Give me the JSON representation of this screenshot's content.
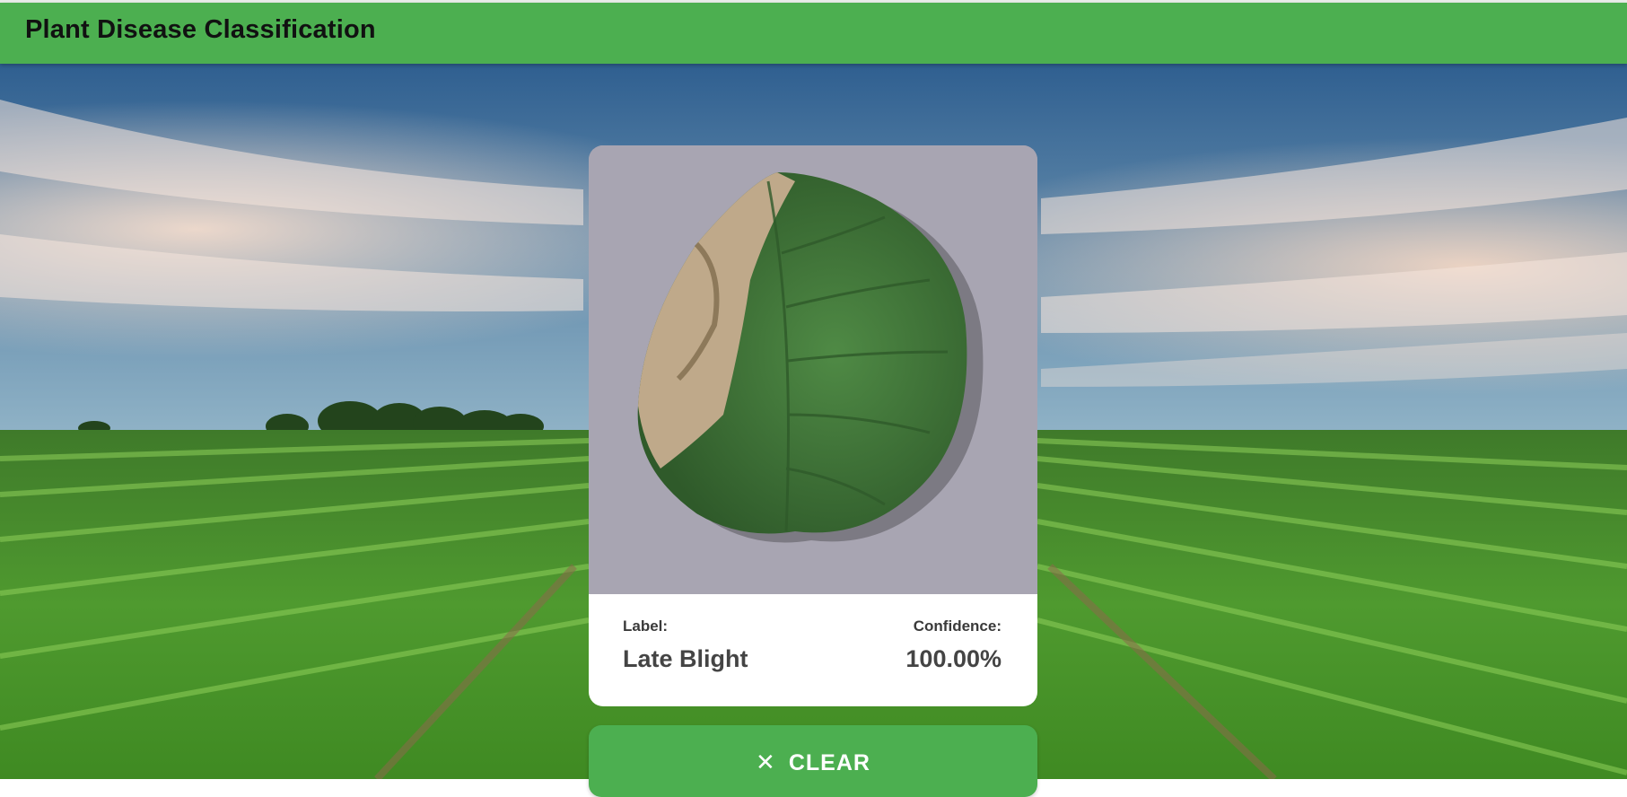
{
  "app": {
    "title": "Plant Disease Classification"
  },
  "result": {
    "label_heading": "Label:",
    "label_value": "Late Blight",
    "confidence_heading": "Confidence:",
    "confidence_value": "100.00%"
  },
  "actions": {
    "clear_label": "CLEAR",
    "clear_icon": "close-icon"
  },
  "colors": {
    "appbar": "#4caf50",
    "button": "#4caf50",
    "panel": "#ffffff"
  }
}
